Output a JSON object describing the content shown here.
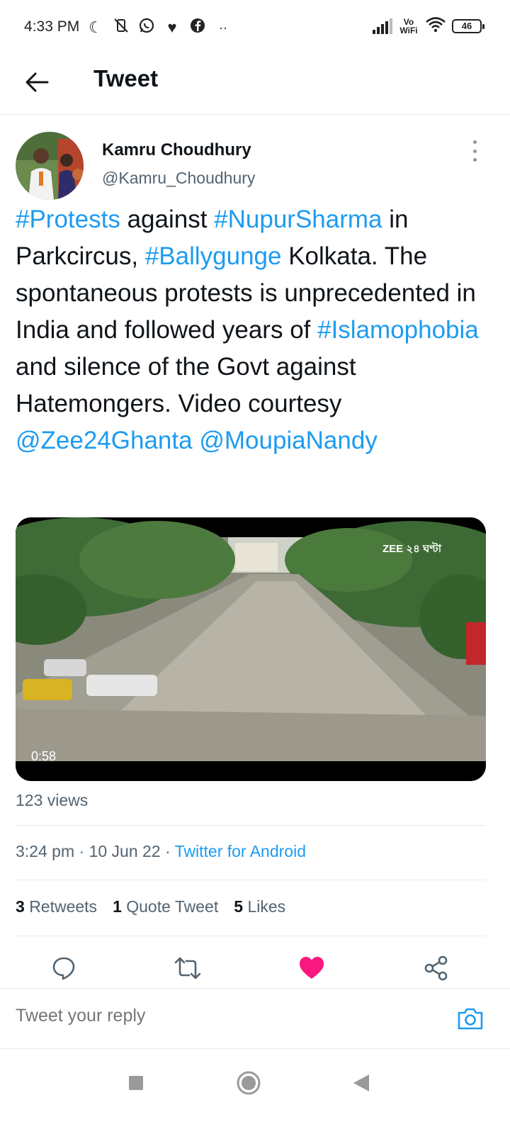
{
  "status_bar": {
    "time": "4:33 PM",
    "left_icons": [
      "moon-icon",
      "vibrate-off-icon",
      "whatsapp-icon",
      "heart-icon",
      "facebook-icon",
      "more-dots-icon"
    ],
    "network_label": "Vo WiFi",
    "battery": "46"
  },
  "header": {
    "title": "Tweet"
  },
  "tweet": {
    "author_name": "Kamru Choudhury",
    "author_handle": "@Kamru_Choudhury",
    "text_parts": [
      {
        "text": "#Protests",
        "link": true
      },
      {
        "text": " against ",
        "link": false
      },
      {
        "text": "#NupurSharma",
        "link": true
      },
      {
        "text": " in Parkcircus, ",
        "link": false
      },
      {
        "text": "#Ballygunge",
        "link": true
      },
      {
        "text": " Kolkata. The spontaneous protests is unprecedented in India and followed years of ",
        "link": false
      },
      {
        "text": "#Islamophobia",
        "link": true
      },
      {
        "text": " and silence of the Govt against Hatemongers. Video courtesy ",
        "link": false
      },
      {
        "text": "@Zee24Ghanta",
        "link": true
      },
      {
        "text": " ",
        "link": false
      },
      {
        "text": "@MoupiaNandy",
        "link": true
      }
    ],
    "video": {
      "duration": "0:58",
      "channel_logo": "ZEE ২৪ ঘণ্টা"
    },
    "views": "123 views",
    "time": "3:24 pm",
    "date": "10 Jun 22",
    "source": "Twitter for Android",
    "stats": {
      "retweets_count": "3",
      "retweets_label": "Retweets",
      "quotes_count": "1",
      "quotes_label": "Quote Tweet",
      "likes_count": "5",
      "likes_label": "Likes"
    }
  },
  "reply": {
    "placeholder": "Tweet your reply"
  },
  "colors": {
    "link": "#1d9bf0",
    "like_active": "#f91880",
    "text": "#0f1419",
    "secondary": "#536471"
  }
}
